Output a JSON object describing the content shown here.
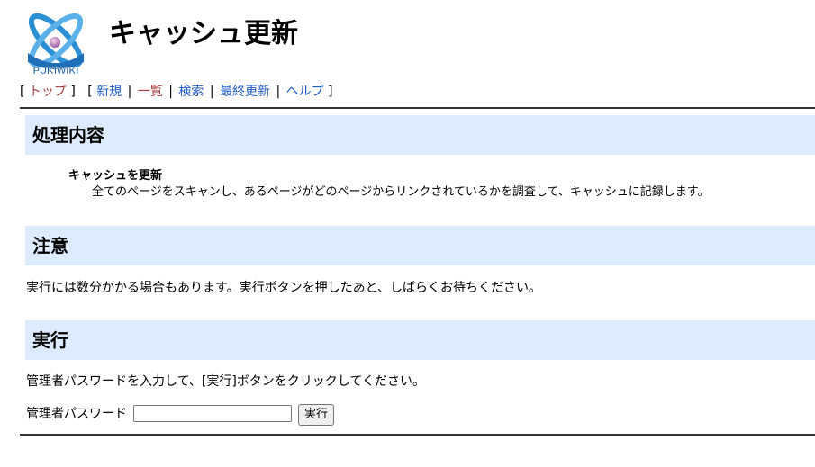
{
  "logo": {
    "text": "PUKIWIKI"
  },
  "page": {
    "title": "キャッシュ更新"
  },
  "navigation": {
    "open_bracket_1": "[",
    "close_bracket_1": "]",
    "open_bracket_2": "[",
    "close_bracket_2": "]",
    "separator": "|",
    "top": "トップ",
    "new": "新規",
    "list": "一覧",
    "search": "検索",
    "recent": "最終更新",
    "help": "ヘルプ"
  },
  "sections": {
    "processing": {
      "heading": "処理内容",
      "term": "キャッシュを更新",
      "description": "全てのページをスキャンし、あるページがどのページからリンクされているかを調査して、キャッシュに記録します。"
    },
    "notice": {
      "heading": "注意",
      "text": "実行には数分かかる場合もあります。実行ボタンを押したあと、しばらくお待ちください。"
    },
    "execute": {
      "heading": "実行",
      "instruction": "管理者パスワードを入力して、[実行]ボタンをクリックしてください。",
      "password_label": "管理者パスワード",
      "password_value": "",
      "button_label": "実行"
    }
  },
  "colors": {
    "heading_bg": "#dcebfd",
    "link": "#215dc6",
    "link_visited": "#a63d40",
    "rule": "#333333"
  }
}
